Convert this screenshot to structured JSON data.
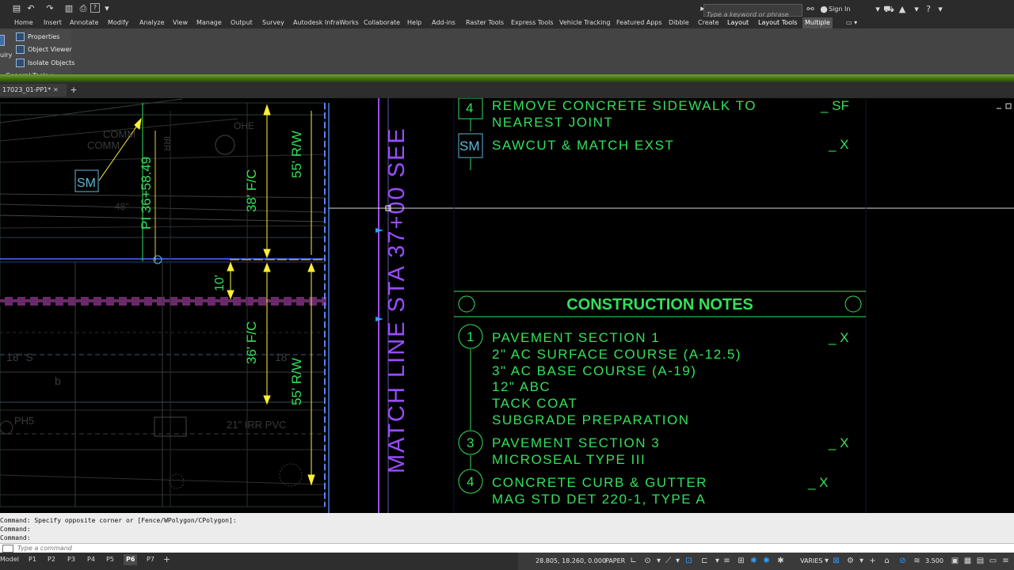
{
  "quick_access": {
    "icons": [
      "new-icon",
      "undo-icon",
      "redo-icon",
      "save-icon",
      "plot-icon",
      "help-icon",
      "dropdown-icon"
    ]
  },
  "search": {
    "placeholder": "Type a keyword or phrase"
  },
  "account": {
    "sign_in": "Sign In"
  },
  "ribbon_tabs": [
    "Home",
    "Insert",
    "Annotate",
    "Modify",
    "Analyze",
    "View",
    "Manage",
    "Output",
    "Survey",
    "Autodesk InfraWorks",
    "Collaborate",
    "Help",
    "Add-ins",
    "Raster Tools",
    "Express Tools",
    "Vehicle Tracking",
    "Featured Apps",
    "Dibble",
    "Create",
    "Layout",
    "Layout Tools",
    "Multiple"
  ],
  "active_tab": "Multiple",
  "panel": {
    "items": [
      "Properties",
      "Object Viewer",
      "Isolate Objects"
    ],
    "title": "General Tools",
    "left_fragment": "uiry"
  },
  "file_tab": {
    "name": "17023_01-PP1*"
  },
  "drawing": {
    "plan_labels": {
      "comm1": "COMM",
      "comm2": "COMM",
      "ohe": "OHE",
      "irr": "IRR",
      "station": "PI 36+58.49",
      "sm_tag": "SM",
      "dim_38": "38' F/C",
      "dim_55_top": "55' R/W",
      "dim_10": "10'",
      "dim_36": "36' F/C",
      "dim_55_bot": "55' R/W",
      "s18": "18\" S",
      "s18b": "18",
      "ph5": "PH5",
      "irr_pvc": "21\" IRR PVC",
      "b": "b",
      "w48": "48\"",
      "match_line": "MATCH LINE STA 37+00 SEE"
    },
    "notes_top": [
      {
        "id": "4",
        "lines": [
          "REMOVE CONCRETE SIDEWALK TO",
          "NEAREST JOINT"
        ],
        "qty": "_ SF"
      },
      {
        "id": "SM",
        "lines": [
          "SAWCUT & MATCH EXST"
        ],
        "qty": "_ X"
      }
    ],
    "construction_notes_title": "CONSTRUCTION NOTES",
    "construction_notes": [
      {
        "id": "1",
        "lines": [
          "PAVEMENT SECTION 1",
          "2\" AC SURFACE COURSE (A-12.5)",
          "3\" AC BASE COURSE (A-19)",
          "12\" ABC",
          "TACK COAT",
          "SUBGRADE PREPARATION"
        ],
        "qty": "_ X"
      },
      {
        "id": "3",
        "lines": [
          "PAVEMENT SECTION 3",
          "MICROSEAL TYPE III"
        ],
        "qty": "_ X"
      },
      {
        "id": "4",
        "lines": [
          "CONCRETE CURB & GUTTER",
          "MAG STD DET 220-1, TYPE A"
        ],
        "qty": "_ X"
      }
    ]
  },
  "command_line": {
    "history": [
      "Command: Specify opposite corner or [Fence/WPolygon/CPolygon]:",
      "Command:",
      "Command:"
    ],
    "placeholder": "Type a command"
  },
  "layout_tabs": [
    "Model",
    "P1",
    "P2",
    "P3",
    "P4",
    "P5",
    "P6",
    "P7"
  ],
  "active_layout": "P6",
  "status": {
    "coords": "28.805, 18.260, 0.000",
    "space": "PAPER",
    "annotation_scale": "VARIES",
    "lineweight": "3.500"
  },
  "colors": {
    "note_green": "#33e05a",
    "plan_cyan": "#5fb8d8",
    "match_line_purple": "#9a4dff",
    "dim_yellow": "#ffee33",
    "ribbon_green": "#6fa42c"
  }
}
